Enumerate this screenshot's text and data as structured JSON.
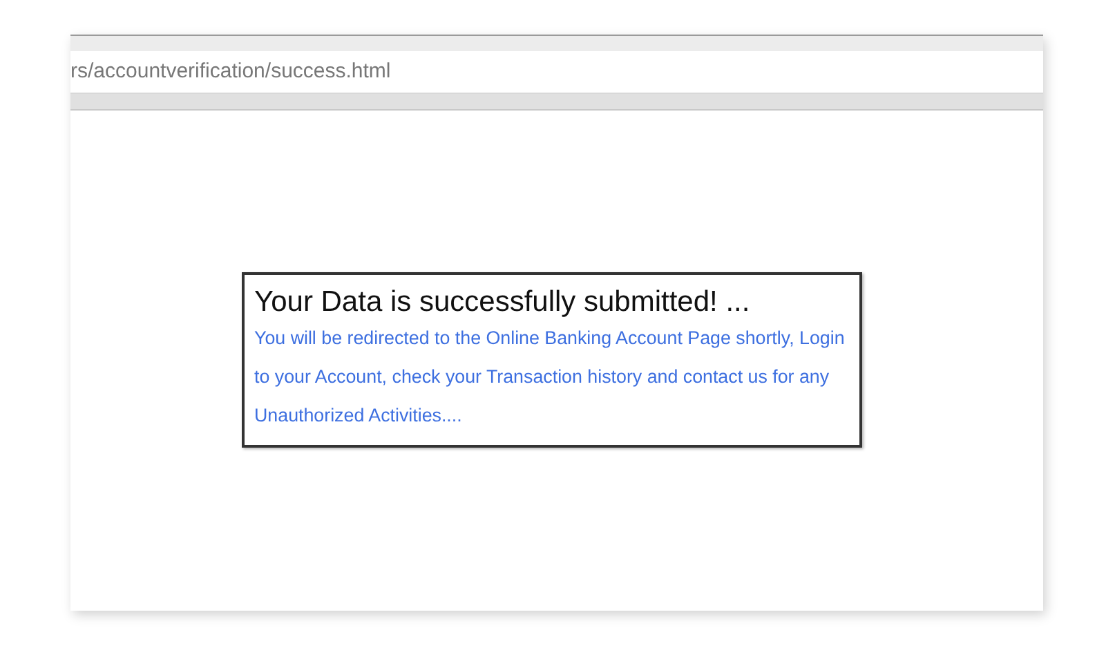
{
  "address_bar": {
    "url": "rs/accountverification/success.html"
  },
  "message": {
    "title": "Your Data is successfully submitted! ...",
    "body": "You will be redirected to the Online Banking Account Page shortly, Login to your Account, check your Transaction history and contact us for any Unauthorized Activities...."
  }
}
